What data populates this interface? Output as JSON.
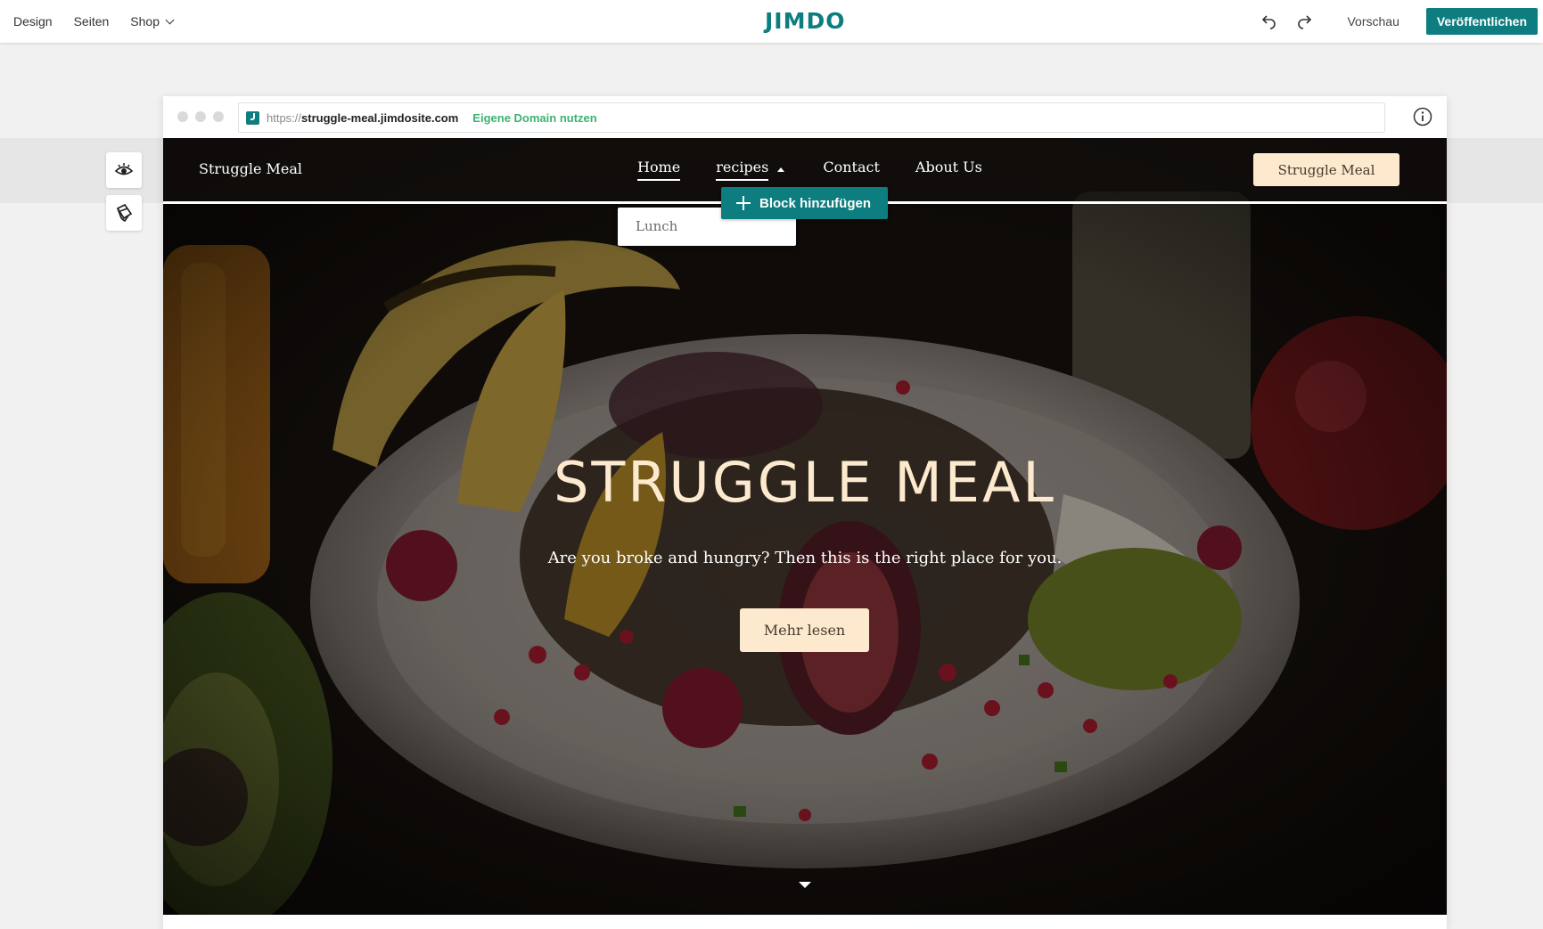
{
  "editor": {
    "nav": {
      "design": "Design",
      "pages": "Seiten",
      "shop": "Shop"
    },
    "logo": "JIMDO",
    "preview": "Vorschau",
    "publish": "Veröffentlichen",
    "brand_color": "#0e7d7f"
  },
  "browser": {
    "url_protocol": "https://",
    "url_domain": "struggle-meal.jimdosite.com",
    "own_domain_link": "Eigene Domain nutzen"
  },
  "site": {
    "title": "Struggle Meal",
    "nav": [
      {
        "label": "Home",
        "active": true
      },
      {
        "label": "recipes",
        "active": false
      },
      {
        "label": "Contact",
        "active": false
      },
      {
        "label": "About Us",
        "active": false
      }
    ],
    "header_button": "Struggle Meal",
    "dropdown_items": [
      "Lunch"
    ],
    "add_block": "Block hinzufügen",
    "hero": {
      "title": "STRUGGLE MEAL",
      "subtitle": "Are you broke and hungry? Then this is the right place for you.",
      "button": "Mehr lesen"
    },
    "accent_color": "#fde9cd"
  }
}
